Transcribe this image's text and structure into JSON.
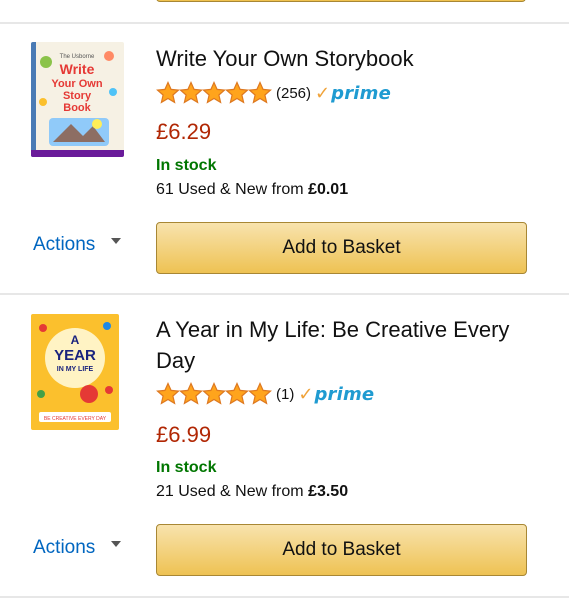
{
  "products": [
    {
      "title": "Write Your Own Storybook",
      "rating_count": "(256)",
      "stars": 5,
      "prime_label": "prime",
      "price": "£6.29",
      "stock": "In stock",
      "offers_prefix": "61 Used & New from ",
      "offers_price": "£0.01",
      "actions_label": "Actions",
      "basket_label": "Add to Basket",
      "cover_text": [
        "The Usborne",
        "Write",
        "Your Own",
        "Story",
        "Book"
      ]
    },
    {
      "title": "A Year in My Life: Be Creative Every Day",
      "rating_count": "(1)",
      "stars": 5,
      "prime_label": "prime",
      "price": "£6.99",
      "stock": "In stock",
      "offers_prefix": "21 Used & New from ",
      "offers_price": "£3.50",
      "actions_label": "Actions",
      "basket_label": "Add to Basket",
      "cover_text": [
        "A",
        "YEAR",
        "IN MY LIFE",
        "BE CREATIVE EVERY DAY"
      ]
    }
  ],
  "colors": {
    "price": "#b12704",
    "stock": "#007600",
    "link": "#0066c0",
    "star": "#ffa41c",
    "prime_check": "#f0a33a",
    "prime_word": "#1f9bd1",
    "button": "#f0c14b"
  },
  "icons": {
    "star": "star-icon",
    "prime_check": "check-icon",
    "caret": "caret-down-icon"
  }
}
